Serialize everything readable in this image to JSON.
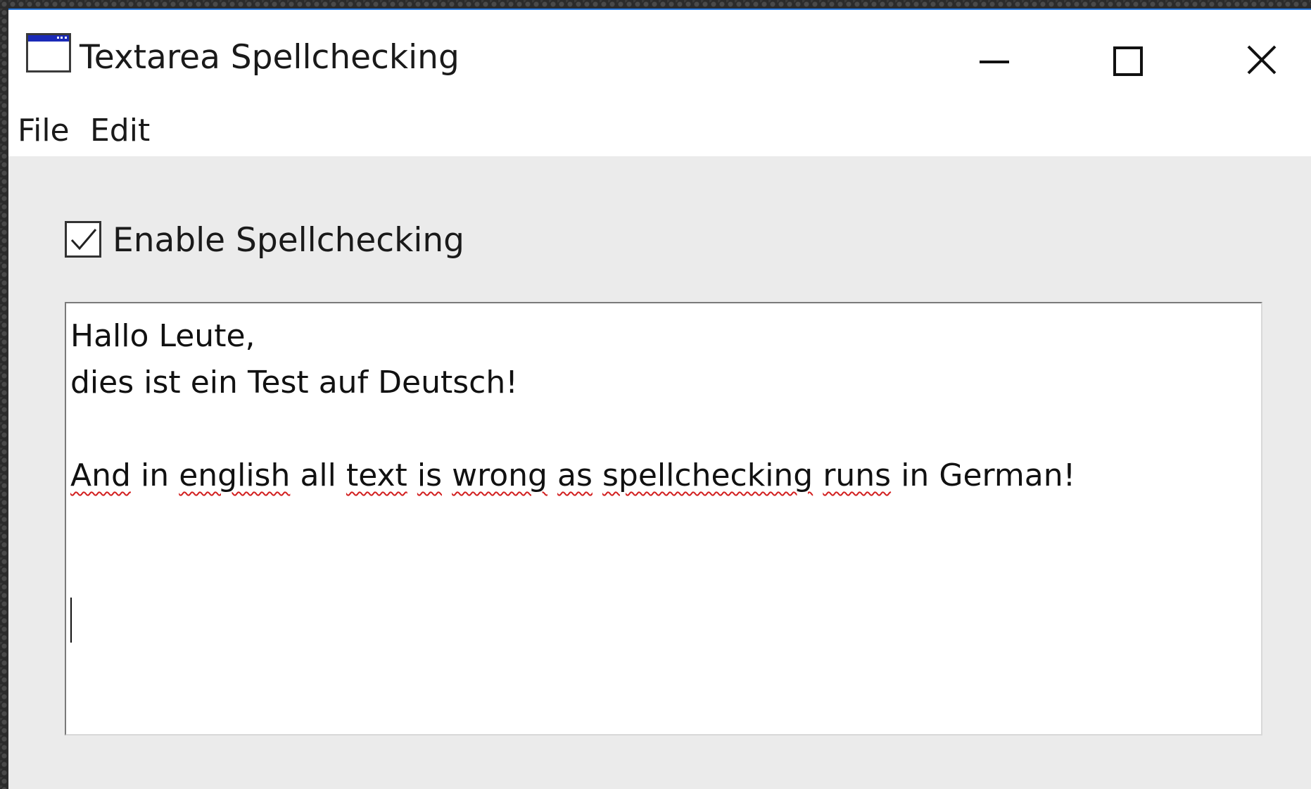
{
  "window": {
    "title": "Textarea Spellchecking",
    "controls": {
      "minimize": "minimize-icon",
      "maximize": "maximize-icon",
      "close": "close-icon"
    },
    "accent_color": "#1e6fd6"
  },
  "menu": {
    "file": "File",
    "edit": "Edit"
  },
  "checkbox": {
    "label": "Enable Spellchecking",
    "checked": true
  },
  "textarea": {
    "lines": [
      {
        "words": [
          {
            "text": "Hallo",
            "misspelled": false
          },
          {
            "text": "Leute,",
            "misspelled": false
          }
        ]
      },
      {
        "words": [
          {
            "text": "dies",
            "misspelled": false
          },
          {
            "text": "ist",
            "misspelled": false
          },
          {
            "text": "ein",
            "misspelled": false
          },
          {
            "text": "Test",
            "misspelled": false
          },
          {
            "text": "auf",
            "misspelled": false
          },
          {
            "text": "Deutsch!",
            "misspelled": false
          }
        ]
      },
      {
        "words": []
      },
      {
        "words": [
          {
            "text": "And",
            "misspelled": true
          },
          {
            "text": "in",
            "misspelled": false
          },
          {
            "text": "english",
            "misspelled": true
          },
          {
            "text": "all",
            "misspelled": false
          },
          {
            "text": "text",
            "misspelled": true
          },
          {
            "text": "is",
            "misspelled": true
          },
          {
            "text": "wrong",
            "misspelled": true
          },
          {
            "text": "as",
            "misspelled": true
          },
          {
            "text": "spellchecking",
            "misspelled": true
          },
          {
            "text": "runs",
            "misspelled": true
          },
          {
            "text": "in",
            "misspelled": false
          },
          {
            "text": "German!",
            "misspelled": false
          }
        ]
      }
    ],
    "spellcheck_underline_color": "#d21f1f"
  }
}
